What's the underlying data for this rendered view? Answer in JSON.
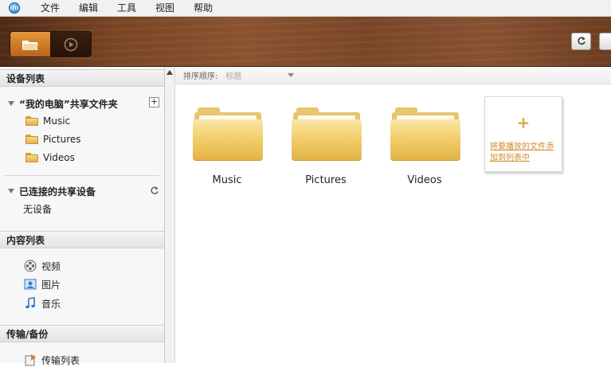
{
  "menu": [
    "文件",
    "编辑",
    "工具",
    "视图",
    "帮助"
  ],
  "app_icon_text": "()))",
  "sidebar": {
    "devices_header": "设备列表",
    "my_computer": "“我的电脑”共享文件夹",
    "folders": [
      "Music",
      "Pictures",
      "Videos"
    ],
    "connected_header": "已连接的共享设备",
    "no_device": "无设备",
    "content_header": "内容列表",
    "content_items": [
      "视频",
      "图片",
      "音乐"
    ],
    "transfer_header": "传输/备份",
    "transfer_items": [
      "传输列表"
    ]
  },
  "sort": {
    "label": "排序顺序:",
    "value": "标题"
  },
  "grid": {
    "folders": [
      "Music",
      "Pictures",
      "Videos"
    ],
    "add_card_line1": "将要播放的文件添",
    "add_card_line2": "加到列表中"
  },
  "colors": {
    "wood": "#7b4727",
    "accent": "#e2a64a",
    "folder": "#f3cf6e"
  },
  "icons": [
    "folder-icon",
    "play-icon",
    "refresh-icon",
    "video-icon",
    "picture-icon",
    "music-note-icon",
    "transfer-icon"
  ]
}
